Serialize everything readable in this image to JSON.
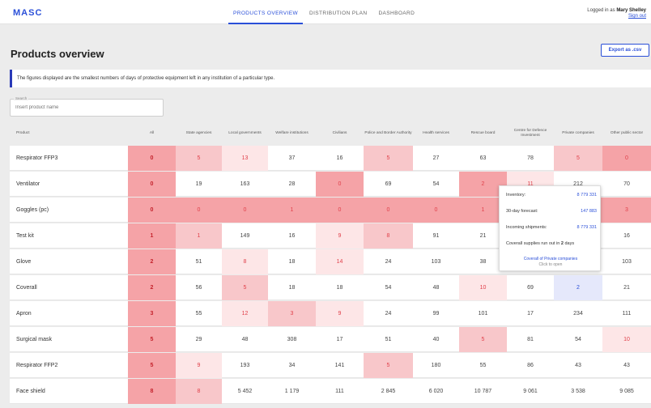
{
  "header": {
    "logo": "MASC",
    "nav": [
      "PRODUCTS OVERVIEW",
      "DISTRIBUTION PLAN",
      "DASHBOARD"
    ],
    "logged_in_prefix": "Logged in as",
    "user": "Mary Shelley",
    "sign_out": "Sign out"
  },
  "page": {
    "title": "Products overview",
    "export_label": "Export as .csv",
    "info": "The figures displayed are the smallest numbers of days of protective equipment left in any institution of a particular type.",
    "search_label": "Search",
    "search_placeholder": "Insert product name"
  },
  "colors": {
    "accent": "#2a4fd8",
    "critical": "#f5a3a7",
    "warning": "#f8c7ca",
    "low": "#fde6e7",
    "selected": "#e5e8fb"
  },
  "table": {
    "columns": [
      "Product",
      "All",
      "State agencies",
      "Local governments",
      "Welfare institutions",
      "Civilians",
      "Police and Border Authority",
      "Health services",
      "Rescue board",
      "Centre for Defence Investment",
      "Private companies",
      "Other public sector"
    ],
    "rows": [
      {
        "name": "Respirator FFP3",
        "values": [
          "0",
          "5",
          "13",
          "37",
          "16",
          "5",
          "27",
          "63",
          "78",
          "5",
          "0"
        ],
        "levels": [
          3,
          2,
          1,
          0,
          0,
          2,
          0,
          0,
          0,
          2,
          3
        ]
      },
      {
        "name": "Ventilator",
        "values": [
          "0",
          "19",
          "163",
          "28",
          "0",
          "69",
          "54",
          "2",
          "11",
          "212",
          "70"
        ],
        "levels": [
          3,
          0,
          0,
          0,
          3,
          0,
          0,
          3,
          1,
          0,
          0
        ]
      },
      {
        "name": "Goggles (pc)",
        "values": [
          "0",
          "0",
          "0",
          "1",
          "0",
          "0",
          "0",
          "1",
          "",
          "",
          "3"
        ],
        "levels": [
          3,
          3,
          3,
          3,
          3,
          3,
          3,
          3,
          3,
          3,
          3
        ]
      },
      {
        "name": "Test kit",
        "values": [
          "1",
          "1",
          "149",
          "16",
          "9",
          "8",
          "91",
          "21",
          "",
          "",
          "16"
        ],
        "levels": [
          3,
          2,
          0,
          0,
          1,
          2,
          0,
          0,
          0,
          0,
          0
        ]
      },
      {
        "name": "Glove",
        "values": [
          "2",
          "51",
          "8",
          "18",
          "14",
          "24",
          "103",
          "38",
          "",
          "",
          "103"
        ],
        "levels": [
          3,
          0,
          1,
          0,
          1,
          0,
          0,
          0,
          0,
          0,
          0
        ]
      },
      {
        "name": "Coverall",
        "values": [
          "2",
          "56",
          "5",
          "18",
          "18",
          "54",
          "48",
          "10",
          "69",
          "2",
          "21"
        ],
        "levels": [
          3,
          0,
          2,
          0,
          0,
          0,
          0,
          1,
          0,
          9,
          0
        ]
      },
      {
        "name": "Apron",
        "values": [
          "3",
          "55",
          "12",
          "3",
          "9",
          "24",
          "99",
          "101",
          "17",
          "234",
          "111"
        ],
        "levels": [
          3,
          0,
          1,
          2,
          1,
          0,
          0,
          0,
          0,
          0,
          0
        ]
      },
      {
        "name": "Surgical mask",
        "values": [
          "5",
          "29",
          "48",
          "308",
          "17",
          "51",
          "40",
          "5",
          "81",
          "54",
          "10"
        ],
        "levels": [
          3,
          0,
          0,
          0,
          0,
          0,
          0,
          2,
          0,
          0,
          1
        ]
      },
      {
        "name": "Respirator FFP2",
        "values": [
          "5",
          "9",
          "193",
          "34",
          "141",
          "5",
          "180",
          "55",
          "86",
          "43",
          "43"
        ],
        "levels": [
          3,
          1,
          0,
          0,
          0,
          2,
          0,
          0,
          0,
          0,
          0
        ]
      },
      {
        "name": "Face shield",
        "values": [
          "8",
          "8",
          "5 452",
          "1 179",
          "111",
          "2 845",
          "6 020",
          "10 787",
          "9 061",
          "3 538",
          "9 085"
        ],
        "levels": [
          3,
          2,
          0,
          0,
          0,
          0,
          0,
          0,
          0,
          0,
          0
        ]
      }
    ]
  },
  "tooltip": {
    "inventory_label": "Inventory:",
    "inventory_value": "8 779 331",
    "forecast_label": "30-day forecast:",
    "forecast_value": "147 883",
    "incoming_label": "Incoming shipments:",
    "incoming_value": "8 779 331",
    "runout_prefix": "Coverall supplies run out in",
    "runout_days": "2",
    "runout_suffix": "days",
    "link": "Coverall of Private companies",
    "hint": "Click to open"
  }
}
